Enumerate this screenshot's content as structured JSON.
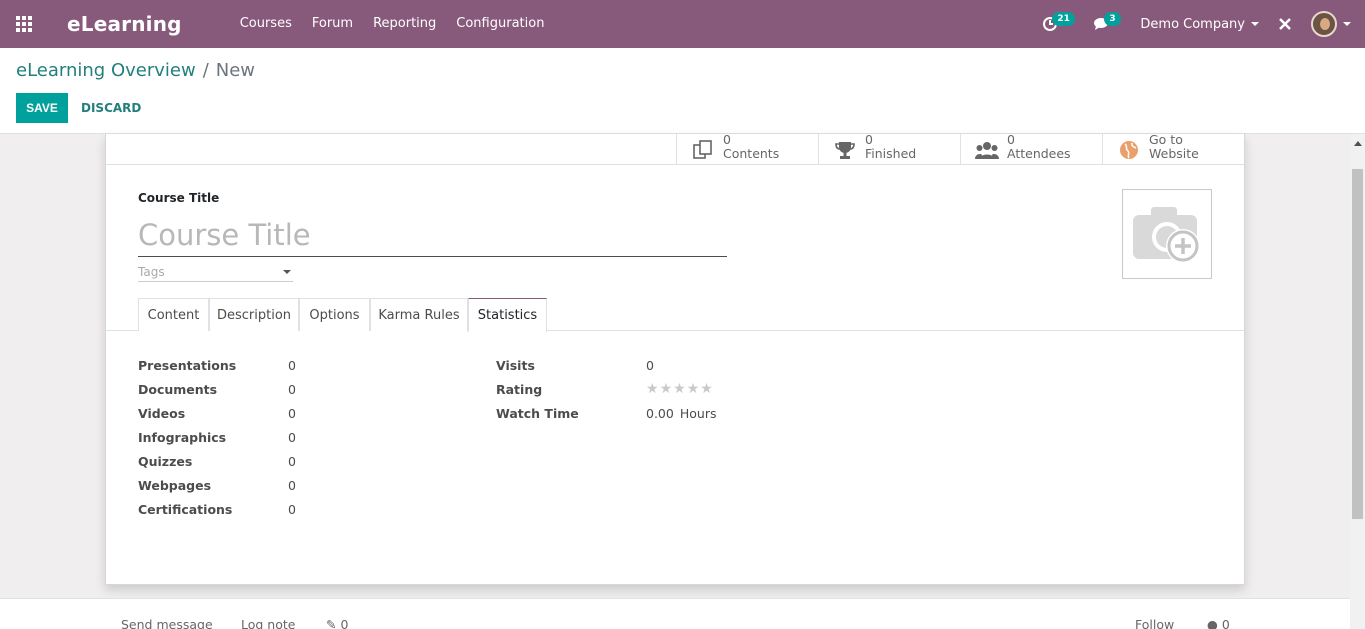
{
  "navbar": {
    "brand": "eLearning",
    "menu": [
      "Courses",
      "Forum",
      "Reporting",
      "Configuration"
    ],
    "activity_count": "21",
    "message_count": "3",
    "company": "Demo Company"
  },
  "control_panel": {
    "breadcrumb_parent": "eLearning Overview",
    "breadcrumb_sep": "/",
    "breadcrumb_current": "New",
    "save_label": "SAVE",
    "discard_label": "DISCARD"
  },
  "stat_buttons": [
    {
      "value": "0",
      "label": "Contents",
      "icon": "copy-icon"
    },
    {
      "value": "0",
      "label": "Finished",
      "icon": "trophy-icon"
    },
    {
      "value": "0",
      "label": "Attendees",
      "icon": "users-icon"
    },
    {
      "value": "Go to",
      "label": "Website",
      "icon": "globe-icon"
    }
  ],
  "form": {
    "course_title_label": "Course Title",
    "course_title_placeholder": "Course Title",
    "tags_placeholder": "Tags"
  },
  "tabs": [
    "Content",
    "Description",
    "Options",
    "Karma Rules",
    "Statistics"
  ],
  "active_tab": "Statistics",
  "statistics_left": [
    {
      "label": "Presentations",
      "value": "0"
    },
    {
      "label": "Documents",
      "value": "0"
    },
    {
      "label": "Videos",
      "value": "0"
    },
    {
      "label": "Infographics",
      "value": "0"
    },
    {
      "label": "Quizzes",
      "value": "0"
    },
    {
      "label": "Webpages",
      "value": "0"
    },
    {
      "label": "Certifications",
      "value": "0"
    }
  ],
  "statistics_right": {
    "visits_label": "Visits",
    "visits_value": "0",
    "rating_label": "Rating",
    "rating_stars": 0,
    "watch_time_label": "Watch Time",
    "watch_time_value": "0.00",
    "watch_time_unit": "Hours"
  },
  "chatter": {
    "send_message": "Send message",
    "log_note": "Log note",
    "attachments": "0",
    "follow": "Follow",
    "followers": "0"
  },
  "colors": {
    "brand": "#875a7b",
    "accent": "#00a09d",
    "link": "#227f7e"
  }
}
